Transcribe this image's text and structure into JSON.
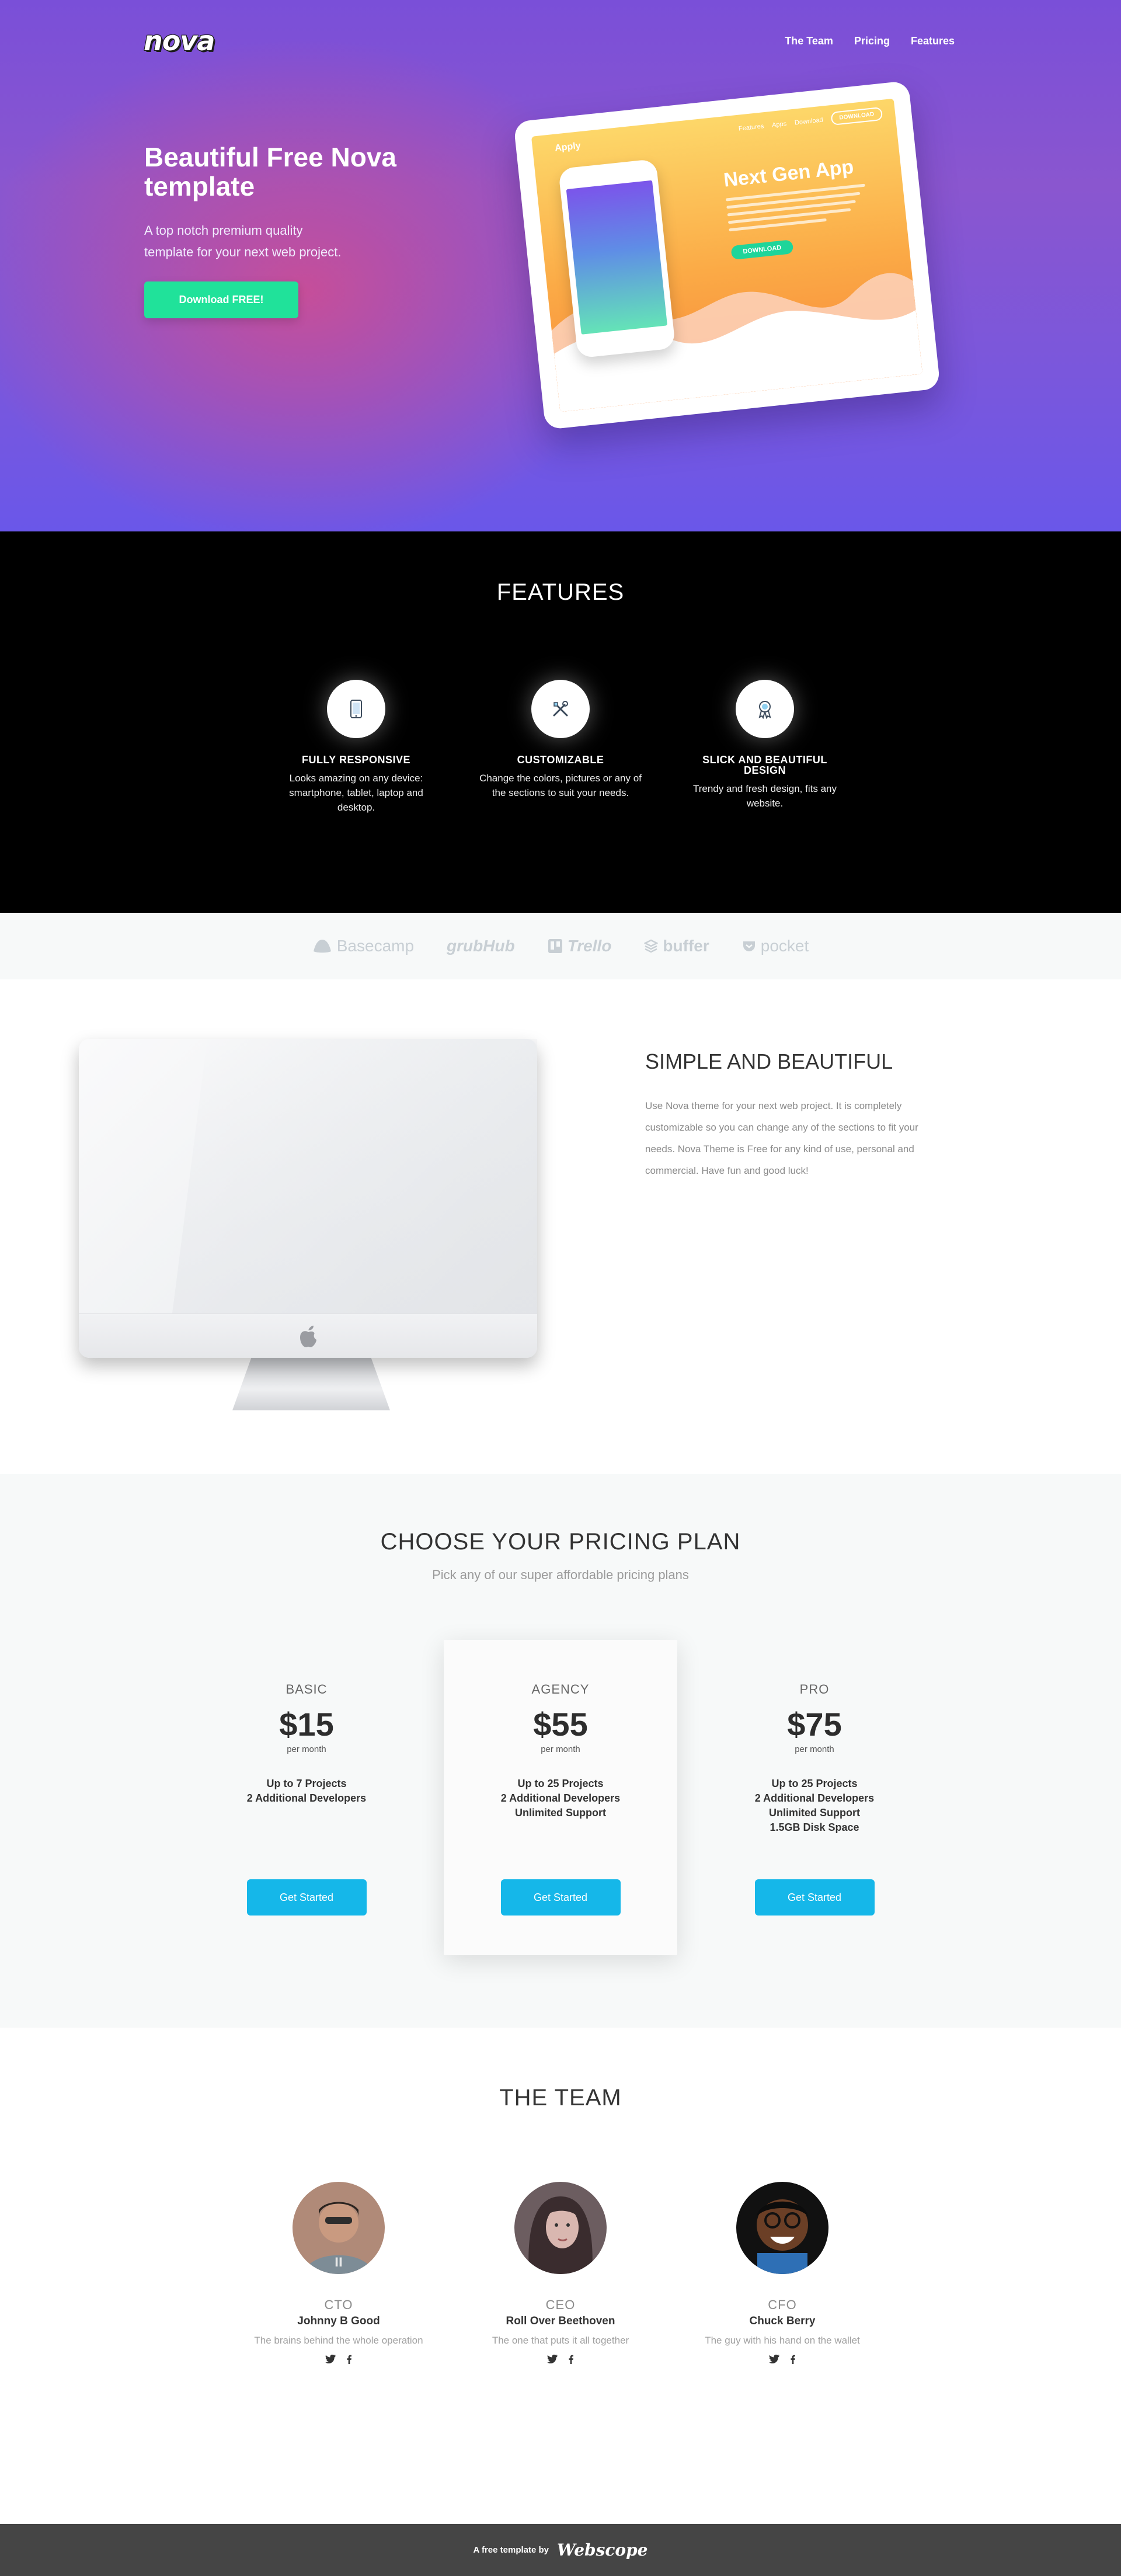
{
  "nav": {
    "logo": "nova",
    "links": [
      "The Team",
      "Pricing",
      "Features"
    ]
  },
  "hero": {
    "title": "Beautiful Free Nova template",
    "subtitle": "A top notch premium quality template for your next web project.",
    "cta": "Download FREE!",
    "mockup": {
      "brand": "Apply",
      "nav": [
        "Features",
        "Apps",
        "Download"
      ],
      "nav_button": "DOWNLOAD",
      "title": "Next Gen App",
      "button": "DOWNLOAD"
    }
  },
  "features": {
    "heading": "FEATURES",
    "items": [
      {
        "icon": "mobile-icon",
        "title": "FULLY RESPONSIVE",
        "desc": "Looks amazing on any device: smartphone, tablet, laptop and desktop."
      },
      {
        "icon": "tools-icon",
        "title": "CUSTOMIZABLE",
        "desc": "Change the colors, pictures or any of the sections to suit your needs."
      },
      {
        "icon": "award-icon",
        "title": "SLICK AND BEAUTIFUL DESIGN",
        "desc": "Trendy and fresh design, fits any website."
      }
    ]
  },
  "logos": [
    "Basecamp",
    "grubHub",
    "Trello",
    "buffer",
    "pocket"
  ],
  "simple": {
    "heading": "SIMPLE AND BEAUTIFUL",
    "body": "Use Nova theme for your next web project. It is completely customizable so you can change any of the sections to fit your needs. Nova Theme is Free for any kind of use, personal and commercial. Have fun and good luck!"
  },
  "pricing": {
    "heading": "CHOOSE YOUR PRICING PLAN",
    "subheading": "Pick any of our super affordable pricing plans",
    "plans": [
      {
        "name": "BASIC",
        "price": "$15",
        "per": "per month",
        "features": [
          "Up to 7 Projects",
          "2 Additional Developers"
        ],
        "cta": "Get Started"
      },
      {
        "name": "AGENCY",
        "price": "$55",
        "per": "per month",
        "features": [
          "Up to 25 Projects",
          "2 Additional Developers",
          "Unlimited Support"
        ],
        "cta": "Get Started"
      },
      {
        "name": "PRO",
        "price": "$75",
        "per": "per month",
        "features": [
          "Up to 25 Projects",
          "2 Additional Developers",
          "Unlimited Support",
          "1.5GB Disk Space"
        ],
        "cta": "Get Started"
      }
    ]
  },
  "team": {
    "heading": "THE TEAM",
    "members": [
      {
        "role": "CTO",
        "name": "Johnny B Good",
        "desc": "The brains behind the whole operation"
      },
      {
        "role": "CEO",
        "name": "Roll Over Beethoven",
        "desc": "The one that puts it all together"
      },
      {
        "role": "CFO",
        "name": "Chuck Berry",
        "desc": "The guy with his hand on the wallet"
      }
    ]
  },
  "footer": {
    "text": "A free template by",
    "brand": "Webscope"
  },
  "colors": {
    "hero_purple": "#7a4fd8",
    "cta_green": "#20e29a",
    "button_blue": "#15b7e9",
    "footer_gray": "#454545"
  }
}
